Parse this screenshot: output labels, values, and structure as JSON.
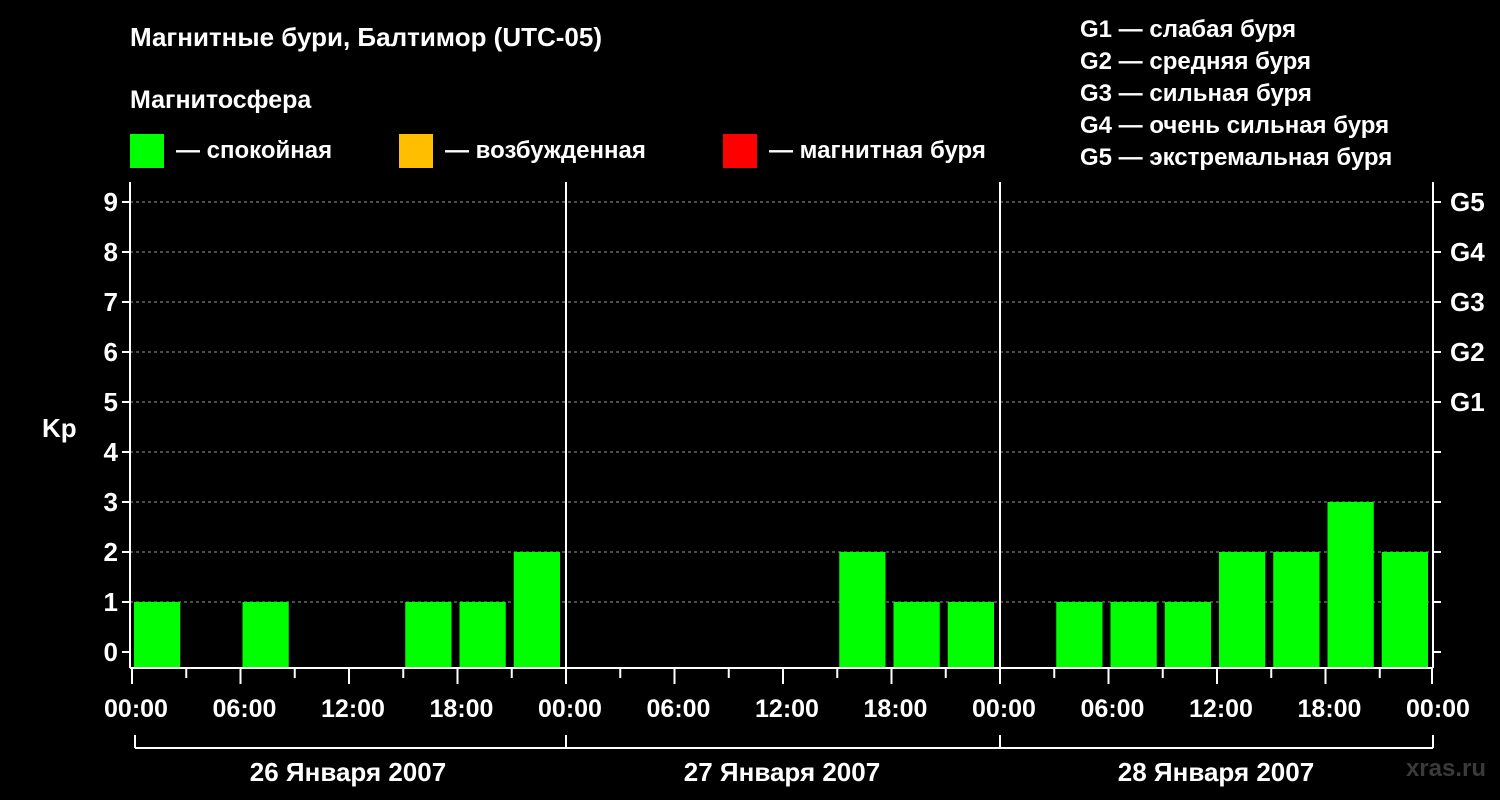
{
  "header": {
    "title": "Магнитные бури, Балтимор (UTC-05)",
    "subtitle": "Магнитосфера"
  },
  "legend": [
    {
      "label": "— спокойная",
      "color": "#00ff00"
    },
    {
      "label": "— возбужденная",
      "color": "#ffbf00"
    },
    {
      "label": "— магнитная буря",
      "color": "#ff0000"
    }
  ],
  "storm_levels": [
    "G1 — слабая буря",
    "G2 — средняя буря",
    "G3 — сильная буря",
    "G4 — очень сильная буря",
    "G5 — экстремальная буря"
  ],
  "watermark": "xras.ru",
  "chart_data": {
    "type": "bar",
    "ylabel": "Kp",
    "ylim": [
      0,
      9
    ],
    "yticks": [
      "0",
      "1",
      "2",
      "3",
      "4",
      "5",
      "6",
      "7",
      "8",
      "9"
    ],
    "right_ticks": [
      {
        "kp": 5,
        "label": "G1"
      },
      {
        "kp": 6,
        "label": "G2"
      },
      {
        "kp": 7,
        "label": "G3"
      },
      {
        "kp": 8,
        "label": "G4"
      },
      {
        "kp": 9,
        "label": "G5"
      }
    ],
    "xticks": [
      "00:00",
      "06:00",
      "12:00",
      "18:00",
      "00:00",
      "06:00",
      "12:00",
      "18:00",
      "00:00",
      "06:00",
      "12:00",
      "18:00",
      "00:00"
    ],
    "days": [
      "26 Января 2007",
      "27 Января 2007",
      "28 Января 2007"
    ],
    "grid": true,
    "interval_hours": 3,
    "values": [
      1,
      null,
      1,
      null,
      null,
      1,
      1,
      2,
      null,
      null,
      null,
      null,
      null,
      2,
      1,
      1,
      null,
      1,
      1,
      1,
      2,
      2,
      3,
      2
    ],
    "quiet_color": "#00ff00"
  }
}
